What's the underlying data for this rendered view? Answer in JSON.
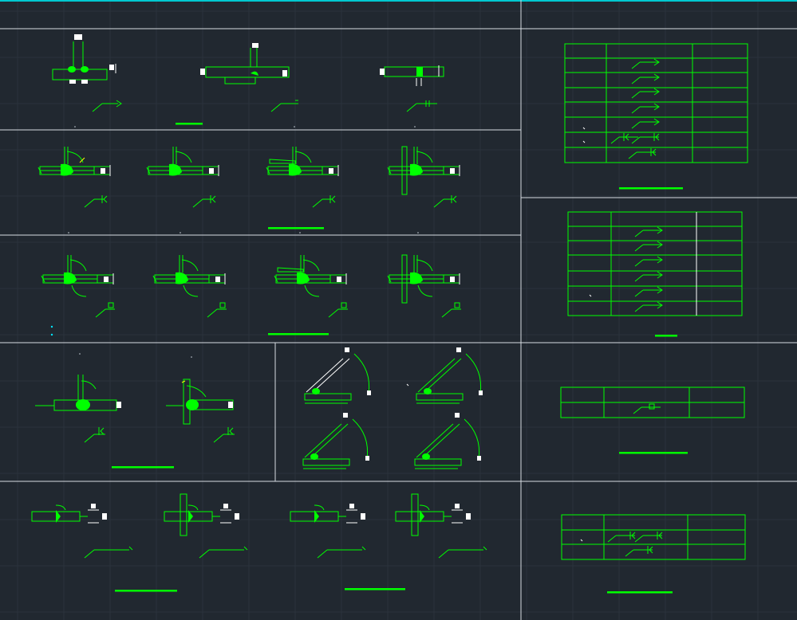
{
  "drawing": {
    "background_color": "#212830",
    "grid_color": "#2b323c",
    "frame_color": "#d8dde2",
    "accent_top_color": "#00c8d0",
    "symbol_color": "#00ff00",
    "block_color": "#ffffff",
    "highlight_color": "#ffff00",
    "cyan_mark_color": "#00e5ff"
  },
  "panels": [
    {
      "id": "butt-weld-details",
      "details": 3,
      "row": 1
    },
    {
      "id": "fillet-weld-details-a",
      "details": 4,
      "row": 2
    },
    {
      "id": "fillet-weld-details-b",
      "details": 4,
      "row": 3
    },
    {
      "id": "tee-weld-details",
      "details": 2,
      "row": 4
    },
    {
      "id": "skewed-weld-details",
      "details": 4,
      "row": 4
    },
    {
      "id": "end-weld-details",
      "details": 4,
      "row": 5
    },
    {
      "id": "symbol-table-1",
      "rows": 8,
      "cols": 3
    },
    {
      "id": "symbol-table-2",
      "rows": 7,
      "cols": 3
    },
    {
      "id": "symbol-table-3",
      "rows": 2,
      "cols": 3
    },
    {
      "id": "symbol-table-4",
      "rows": 3,
      "cols": 3
    }
  ]
}
